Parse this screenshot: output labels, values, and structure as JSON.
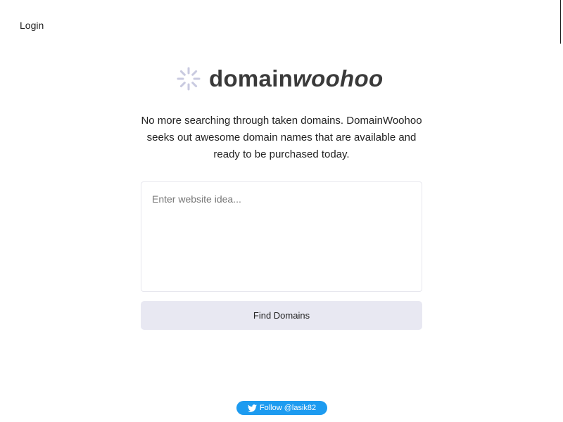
{
  "header": {
    "login_label": "Login"
  },
  "logo": {
    "icon": "spinner-icon",
    "text_part1": "domain",
    "text_part2": "woohoo"
  },
  "tagline": "No more searching through taken domains. DomainWoohoo seeks out awesome domain names that are available and ready to be purchased today.",
  "search": {
    "placeholder": "Enter website idea...",
    "value": ""
  },
  "find_button_label": "Find Domains",
  "twitter": {
    "icon": "twitter-bird-icon",
    "follow_label": "Follow @lasik82"
  },
  "colors": {
    "button_bg": "#e8e8f2",
    "twitter_blue": "#1d9bf0",
    "spinner_color": "#c9cae0",
    "logo_text": "#3a3a3a"
  }
}
